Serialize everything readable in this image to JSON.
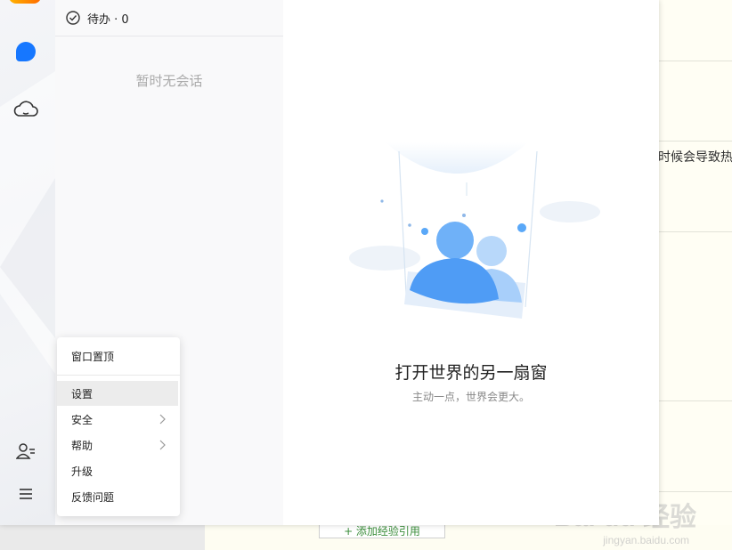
{
  "todo": {
    "label": "待办 · 0"
  },
  "conversations": {
    "empty_text": "暂时无会话"
  },
  "welcome": {
    "title": "打开世界的另一扇窗",
    "subtitle": "主动一点，世界会更大。"
  },
  "menu": {
    "pin_window": "窗口置顶",
    "items": [
      {
        "label": "设置",
        "has_submenu": false
      },
      {
        "label": "安全",
        "has_submenu": true
      },
      {
        "label": "帮助",
        "has_submenu": true
      },
      {
        "label": "升级",
        "has_submenu": false
      },
      {
        "label": "反馈问题",
        "has_submenu": false
      }
    ]
  },
  "background_page": {
    "text": "时候会导致热",
    "button_label": "+ 添加经验引用"
  },
  "watermark": {
    "main": "Bai du 经验",
    "sub": "jingyan.baidu.com"
  },
  "colors": {
    "accent": "#1677ff",
    "illustration_blue": "#5aa8f8"
  }
}
